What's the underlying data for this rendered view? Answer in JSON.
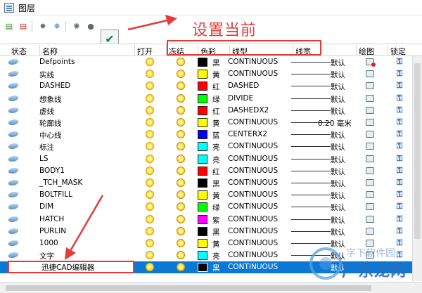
{
  "window": {
    "title": "图层"
  },
  "toolbar": {
    "current_check": "✔"
  },
  "annotation": {
    "callout": "设置当前"
  },
  "columns": {
    "status": "状态",
    "name": "名称",
    "on": "打开",
    "freeze": "冻结",
    "color": "色彩",
    "linetype": "线型",
    "lineweight": "线宽",
    "plot": "绘图",
    "lock": "锁定"
  },
  "rows": [
    {
      "name": "Defpoints",
      "color_name": "黑",
      "color_hex": "#000000",
      "linetype": "CONTINUOUS",
      "lineweight": "默认",
      "plot": false
    },
    {
      "name": "实线",
      "color_name": "黄",
      "color_hex": "#ffff00",
      "linetype": "CONTINUOUS",
      "lineweight": "默认",
      "plot": true
    },
    {
      "name": "DASHED",
      "color_name": "红",
      "color_hex": "#ff0000",
      "linetype": "DASHED",
      "lineweight": "默认",
      "plot": true
    },
    {
      "name": "想象线",
      "color_name": "绿",
      "color_hex": "#00ff00",
      "linetype": "DIVIDE",
      "lineweight": "默认",
      "plot": true
    },
    {
      "name": "虚线",
      "color_name": "红",
      "color_hex": "#ff0000",
      "linetype": "DASHEDX2",
      "lineweight": "默认",
      "plot": true
    },
    {
      "name": "轮廓线",
      "color_name": "黄",
      "color_hex": "#ffff00",
      "linetype": "CONTINUOUS",
      "lineweight": "0.20 毫米",
      "plot": true
    },
    {
      "name": "中心线",
      "color_name": "蓝",
      "color_hex": "#0000ff",
      "linetype": "CENTERX2",
      "lineweight": "默认",
      "plot": true
    },
    {
      "name": "标注",
      "color_name": "亮",
      "color_hex": "#00ffff",
      "linetype": "CONTINUOUS",
      "lineweight": "默认",
      "plot": true
    },
    {
      "name": "LS",
      "color_name": "亮",
      "color_hex": "#00ffff",
      "linetype": "CONTINUOUS",
      "lineweight": "默认",
      "plot": true
    },
    {
      "name": "BODY1",
      "color_name": "红",
      "color_hex": "#ff0000",
      "linetype": "CONTINUOUS",
      "lineweight": "默认",
      "plot": true
    },
    {
      "name": "_TCH_MASK",
      "color_name": "黑",
      "color_hex": "#000000",
      "linetype": "CONTINUOUS",
      "lineweight": "默认",
      "plot": true
    },
    {
      "name": "BOLTFILL",
      "color_name": "黄",
      "color_hex": "#ffff00",
      "linetype": "CONTINUOUS",
      "lineweight": "默认",
      "plot": true
    },
    {
      "name": "DIM",
      "color_name": "绿",
      "color_hex": "#00ff00",
      "linetype": "CONTINUOUS",
      "lineweight": "默认",
      "plot": true
    },
    {
      "name": "HATCH",
      "color_name": "紫",
      "color_hex": "#ff00ff",
      "linetype": "CONTINUOUS",
      "lineweight": "默认",
      "plot": true
    },
    {
      "name": "PURLIN",
      "color_name": "黑",
      "color_hex": "#000000",
      "linetype": "CONTINUOUS",
      "lineweight": "默认",
      "plot": true
    },
    {
      "name": "1000",
      "color_name": "黄",
      "color_hex": "#ffff00",
      "linetype": "CONTINUOUS",
      "lineweight": "默认",
      "plot": true
    },
    {
      "name": "文字",
      "color_name": "亮",
      "color_hex": "#00ffff",
      "linetype": "CONTINUOUS",
      "lineweight": "默认",
      "plot": true
    }
  ],
  "selected_row": {
    "name": "迅捷CAD编辑器",
    "color_name": "黑",
    "color_hex": "#000000",
    "linetype": "CONTINUOUS",
    "lineweight": "默认"
  },
  "watermark": {
    "small": "字下软件园",
    "big": "广东龙网"
  }
}
